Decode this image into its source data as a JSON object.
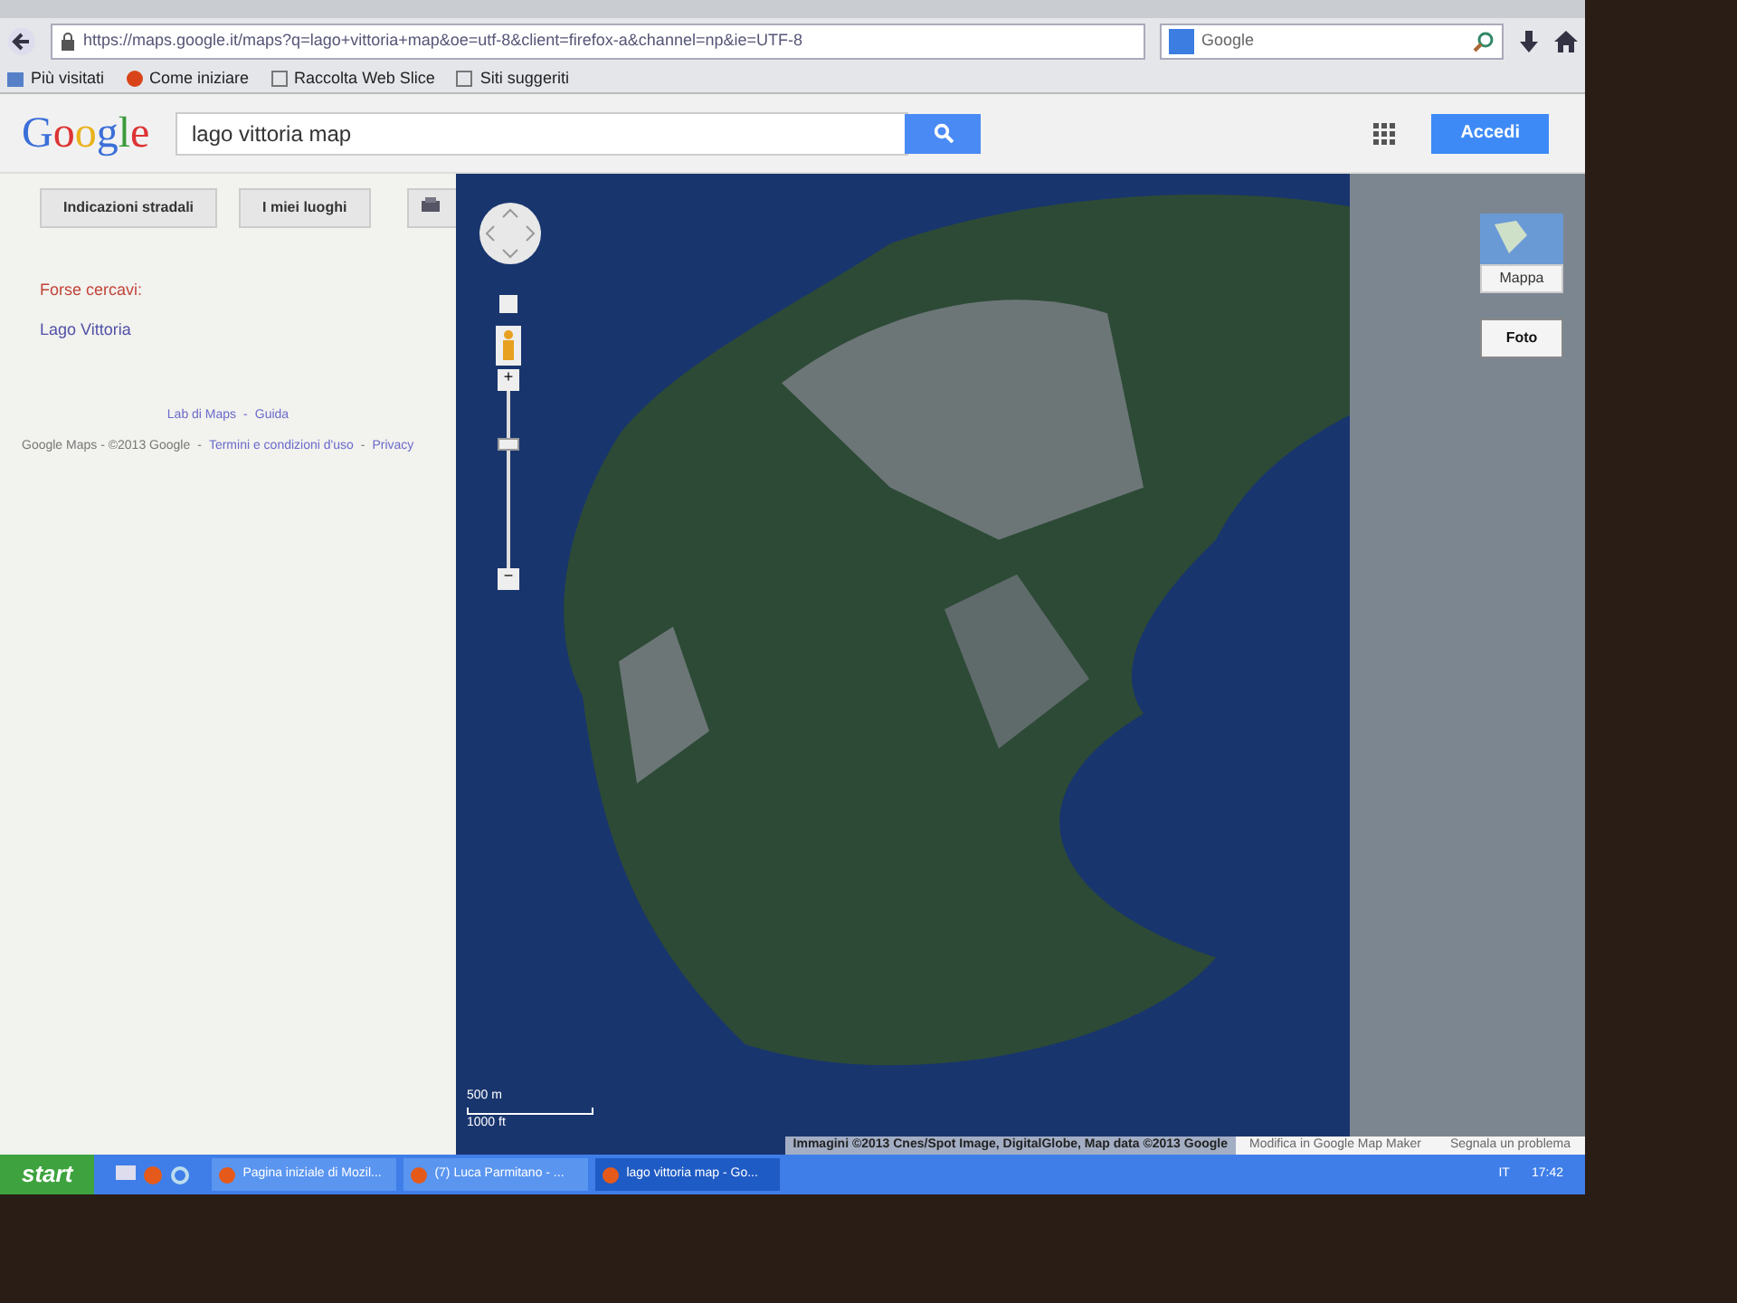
{
  "browser": {
    "url": "https://maps.google.it/maps?q=lago+vittoria+map&oe=utf-8&client=firefox-a&channel=np&ie=UTF-8",
    "search_engine": "Google",
    "bookmarks": [
      {
        "label": "Più visitati",
        "kind": "folder"
      },
      {
        "label": "Come iniziare",
        "kind": "firefox"
      },
      {
        "label": "Raccolta Web Slice",
        "kind": "page"
      },
      {
        "label": "Siti suggeriti",
        "kind": "page"
      }
    ]
  },
  "header": {
    "logo": "Google",
    "search_value": "lago vittoria map",
    "sign_in": "Accedi"
  },
  "sidebar": {
    "buttons": [
      "Indicazioni stradali",
      "I miei luoghi"
    ],
    "suggestion_label": "Forse cercavi:",
    "suggestion_link": "Lago Vittoria",
    "footer_links": [
      "Lab di Maps",
      "Guida"
    ],
    "separator": "-",
    "copyright": "Google Maps - ©2013 Google",
    "legal_links": [
      "Termini e condizioni d'uso",
      "Privacy"
    ]
  },
  "map": {
    "zoom_slider": {
      "level": 0.73,
      "zoom_in": "+",
      "zoom_out": "−"
    },
    "layers": [
      {
        "label": "Mappa",
        "selected": false
      },
      {
        "label": "Foto",
        "selected": true
      }
    ],
    "scale": [
      "500 m",
      "1000 ft"
    ],
    "attribution": "Immagini ©2013 Cnes/Spot Image, DigitalGlobe, Map data ©2013 Google",
    "edit_link": "Modifica in Google Map Maker",
    "report_link": "Segnala un problema"
  },
  "taskbar": {
    "start": "start",
    "windows": [
      {
        "label": "Pagina iniziale di Mozil...",
        "selected": false
      },
      {
        "label": "(7) Luca Parmitano - ...",
        "selected": false
      },
      {
        "label": "lago vittoria map - Go...",
        "selected": true
      }
    ],
    "language": "IT",
    "clock": "17:42"
  }
}
